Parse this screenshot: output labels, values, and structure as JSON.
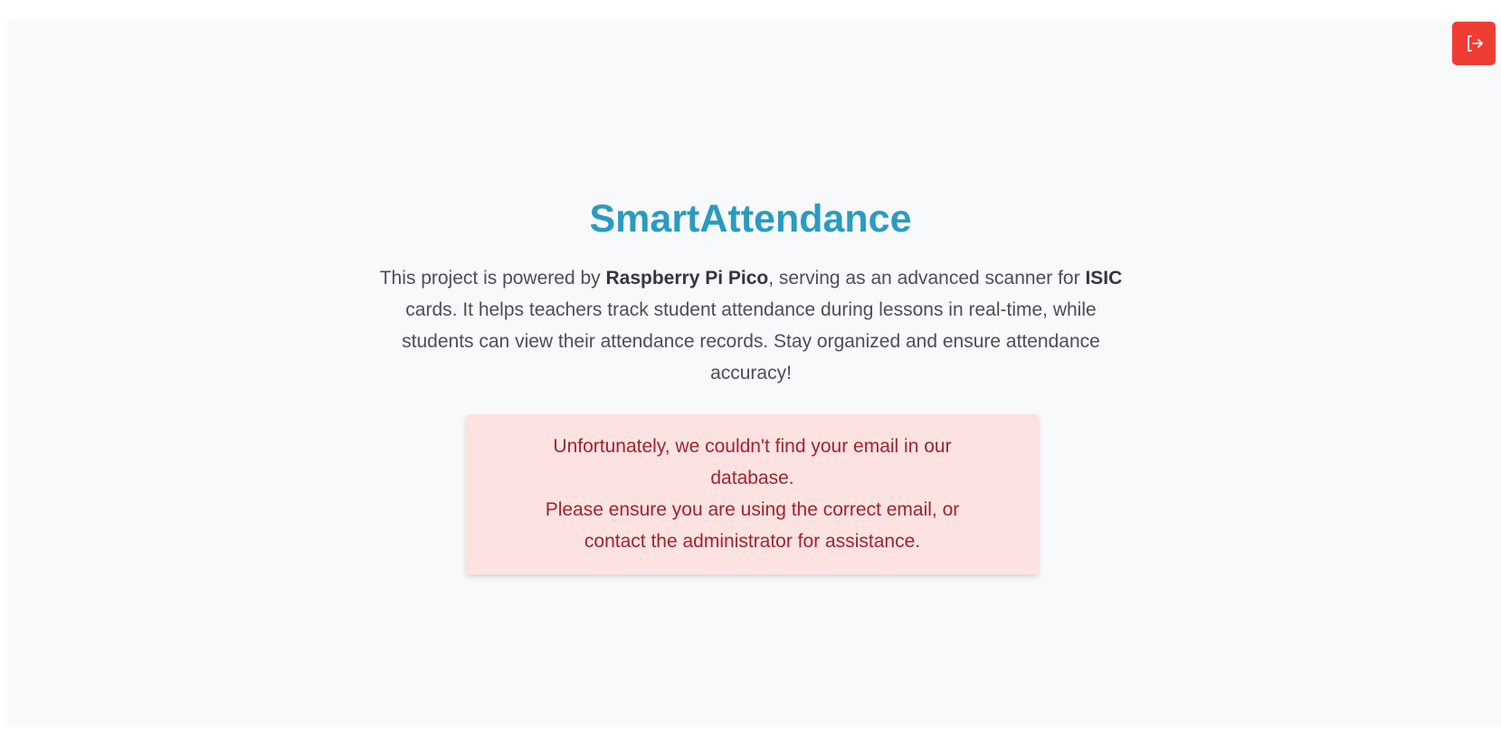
{
  "header": {
    "logout_icon": "logout-icon",
    "logout_color": "#ef3d33"
  },
  "hero": {
    "title": "SmartAttendance",
    "description": {
      "part1": "This project is powered by ",
      "bold1": "Raspberry Pi Pico",
      "part2": ", serving as an advanced scanner for ",
      "bold2": "ISIC",
      "part3": " cards. It helps teachers track student attendance during lessons in real-time, while students can view their attendance records. Stay organized and ensure attendance accuracy!"
    }
  },
  "alert": {
    "line1": "Unfortunately, we couldn't find your email in our database.",
    "line2": "Please ensure you are using the correct email, or contact the administrator for assistance."
  }
}
